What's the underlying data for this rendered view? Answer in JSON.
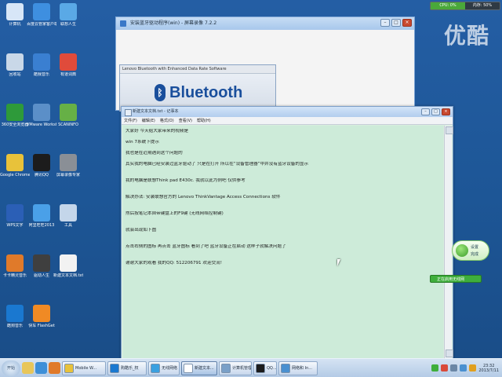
{
  "system_monitor": {
    "cpu": "CPU: 0%",
    "mem": "内存: 50%"
  },
  "watermark": "优酷",
  "desktop_icons": [
    {
      "label": "计算机",
      "icon": "computer-icon",
      "color": "#d7e6f7"
    },
    {
      "label": "百度云管家客户端",
      "icon": "baidu-cloud-icon",
      "color": "#3e8fe0"
    },
    {
      "label": "联想人生",
      "icon": "lenovo-life-icon",
      "color": "#5aa9e6"
    },
    {
      "label": "回收站",
      "icon": "recycle-bin-icon",
      "color": "#c9d8e8"
    },
    {
      "label": "酷我音乐",
      "icon": "kuwo-music-icon",
      "color": "#3a7fd1"
    },
    {
      "label": "有道词典",
      "icon": "youdao-dict-icon",
      "color": "#e04b3b"
    },
    {
      "label": "360安全浏览器",
      "icon": "360-browser-icon",
      "color": "#2e9a3a"
    },
    {
      "label": "VMware Workstation",
      "icon": "vmware-icon",
      "color": "#5b8fc8"
    },
    {
      "label": "SCANINFO",
      "icon": "scan-icon",
      "color": "#66b046"
    },
    {
      "label": "Google Chrome",
      "icon": "chrome-icon",
      "color": "#e8c23a"
    },
    {
      "label": "腾讯QQ",
      "icon": "qq-icon",
      "color": "#1c1c1c"
    },
    {
      "label": "屏幕录像专家",
      "icon": "recorder-icon",
      "color": "#8a8f96"
    },
    {
      "label": "WPS文字",
      "icon": "wps-icon",
      "color": "#2b5fb6"
    },
    {
      "label": "阿里旺旺2013",
      "icon": "aliwangwang-icon",
      "color": "#4aa0e8"
    },
    {
      "label": "工具",
      "icon": "tools-icon",
      "color": "#c4d6ea"
    },
    {
      "label": "卡卡精灵音乐",
      "icon": "music-icon",
      "color": "#e07a2a"
    },
    {
      "label": "驱动人生",
      "icon": "driver-icon",
      "color": "#3f3f3f"
    },
    {
      "label": "新建文本文档.txt",
      "icon": "text-file-icon",
      "color": "#f2f2f2"
    },
    {
      "label": "酷狗音乐",
      "icon": "kugou-icon",
      "color": "#1a78d0"
    },
    {
      "label": "快车 FlashGet",
      "icon": "flashget-icon",
      "color": "#f08a24"
    }
  ],
  "bg_window": {
    "title": "安装蓝牙驱动程序(win) - 屏幕录像 7.2.2"
  },
  "bt_installer": {
    "caption": "Lenovo Bluetooth with Enhanced Data Rate Software",
    "logo_text": "Bluetooth",
    "logo_rune": "ᛒ"
  },
  "notepad": {
    "title": "新建文本文档.txt - 记事本",
    "menu": [
      "文件(F)",
      "编辑(E)",
      "格式(O)",
      "查看(V)",
      "帮助(H)"
    ],
    "lines": [
      "大家好  今天给大家带来的视频是",
      "",
      "win 7系统下提示",
      "",
      "我也是在近期遇到这个问题的",
      "",
      "其实我的电脑已经安装过蓝牙驱动了  只是在打开 所以在“设备管理器”中并没有蓝牙设备的显示",
      "",
      "",
      "我的电脑是联想Think pad E430c. 我就以此为例吧  仅供参考",
      "",
      "",
      "解决办法: 安装联想官方的 Lenovo ThinkVantage Access Connections 软件",
      "",
      "",
      "然后按笔记本自带键盘上的F9键 (无线网络控制键)",
      "",
      "",
      "就会出现如下图",
      "",
      "",
      "点击右侧的图标  再点击 蓝牙图标 看到了吧  蓝牙设备正在启动  这样子就解决问题了",
      "",
      "",
      "谢谢大家的观看  我的QQ: 512206791  欢迎交流!"
    ]
  },
  "bubble": {
    "line1": "设置",
    "line2": "完成"
  },
  "green_bar": "正在启用无线网",
  "taskbar": {
    "start_label": "开始",
    "quick_launch": [
      {
        "icon": "folder-icon",
        "color": "#e8c65a"
      },
      {
        "icon": "ie-icon",
        "color": "#3d8fd8"
      },
      {
        "icon": "media-icon",
        "color": "#e07a2a"
      }
    ],
    "buttons": [
      {
        "label": "Mobile W...",
        "icon": "chrome-icon",
        "color": "#e8c23a",
        "active": false
      },
      {
        "label": "购酷乐_权",
        "icon": "kugou-icon",
        "color": "#1a78d0",
        "active": false
      },
      {
        "label": "无线网络",
        "icon": "network-icon",
        "color": "#3aa0e0",
        "active": false
      },
      {
        "label": "新建文本...",
        "icon": "notepad-icon",
        "color": "#ffffff",
        "active": true
      },
      {
        "label": "计算机管理",
        "icon": "mgmt-icon",
        "color": "#7aa0c8",
        "active": false
      },
      {
        "label": "QQ...",
        "icon": "qq-icon",
        "color": "#1c1c1c",
        "active": false
      },
      {
        "label": "网络和 In...",
        "icon": "network-center-icon",
        "color": "#4a90d0",
        "active": false
      }
    ],
    "tray_icons": [
      {
        "icon": "battery-icon",
        "color": "#3fae3c"
      },
      {
        "icon": "ime-icon",
        "color": "#d94a3a"
      },
      {
        "icon": "volume-icon",
        "color": "#6b87a6"
      },
      {
        "icon": "wifi-icon",
        "color": "#4a90d0"
      },
      {
        "icon": "flag-icon",
        "color": "#e0a020"
      }
    ],
    "clock_time": "23:32",
    "clock_date": "2013/7/11"
  }
}
